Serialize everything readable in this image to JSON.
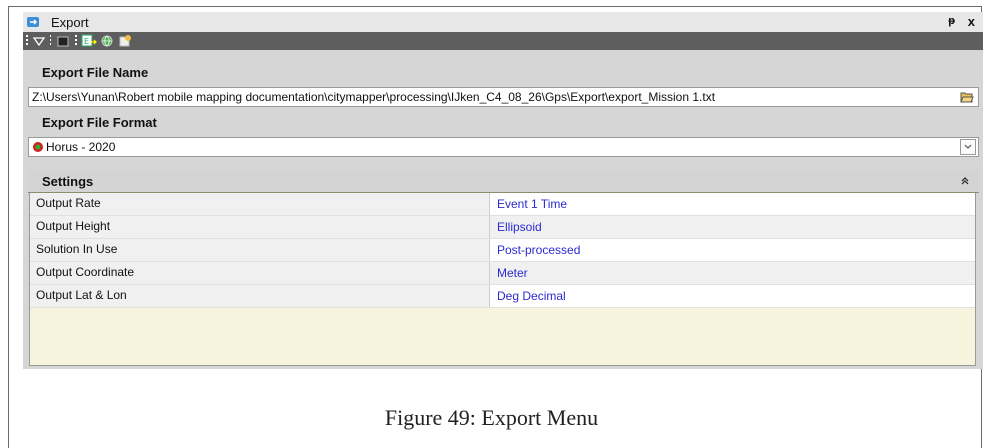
{
  "window": {
    "title": "Export",
    "pin_glyph": "ᴘ",
    "close_glyph": "x"
  },
  "toolbar": {
    "icons": [
      "dropdown-arrow-icon",
      "black-square-icon",
      "export-icon",
      "globe-icon",
      "settings-icon"
    ]
  },
  "export_file_name": {
    "header": "Export File Name",
    "path": "Z:\\Users\\Yunan\\Robert mobile mapping documentation\\citymapper\\processing\\IJken_C4_08_26\\Gps\\Export\\export_Mission 1.txt"
  },
  "export_file_format": {
    "header": "Export File Format",
    "selected": "Horus - 2020"
  },
  "settings": {
    "header": "Settings",
    "rows": [
      {
        "key": "Output Rate",
        "value": "Event 1 Time"
      },
      {
        "key": "Output Height",
        "value": "Ellipsoid"
      },
      {
        "key": "Solution In Use",
        "value": "Post-processed"
      },
      {
        "key": "Output Coordinate",
        "value": "Meter"
      },
      {
        "key": "Output Lat & Lon",
        "value": "Deg Decimal"
      }
    ]
  },
  "caption": "Figure 49: Export Menu",
  "colors": {
    "value_text": "#2b2bd0",
    "grid_empty": "#f6f4dc",
    "toolbar_bg": "#5e5e5e"
  }
}
